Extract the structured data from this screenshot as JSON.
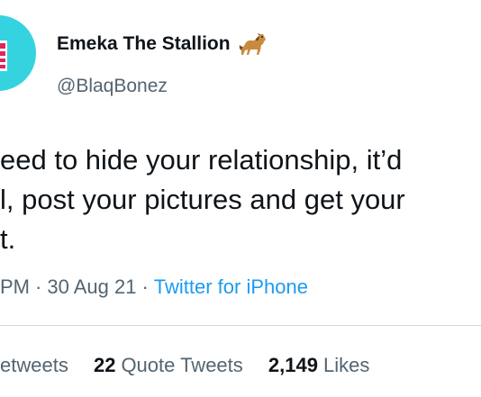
{
  "author": {
    "display_name": "Emeka The Stallion",
    "handle": "@BlaqBonez",
    "emoji_icon": "horse-icon",
    "avatar_color": "#35d3e0"
  },
  "tweet": {
    "lines": [
      "eed to hide your relationship, it’d",
      "l, post your pictures and get your",
      "t."
    ]
  },
  "meta": {
    "time": "PM",
    "separator": "·",
    "date": "30 Aug 21",
    "source": "Twitter for iPhone",
    "source_color": "#1d9bf0"
  },
  "stats": {
    "retweets_label": "etweets",
    "quote_tweets_count": "22",
    "quote_tweets_label": "Quote Tweets",
    "likes_count": "2,149",
    "likes_label": "Likes"
  }
}
